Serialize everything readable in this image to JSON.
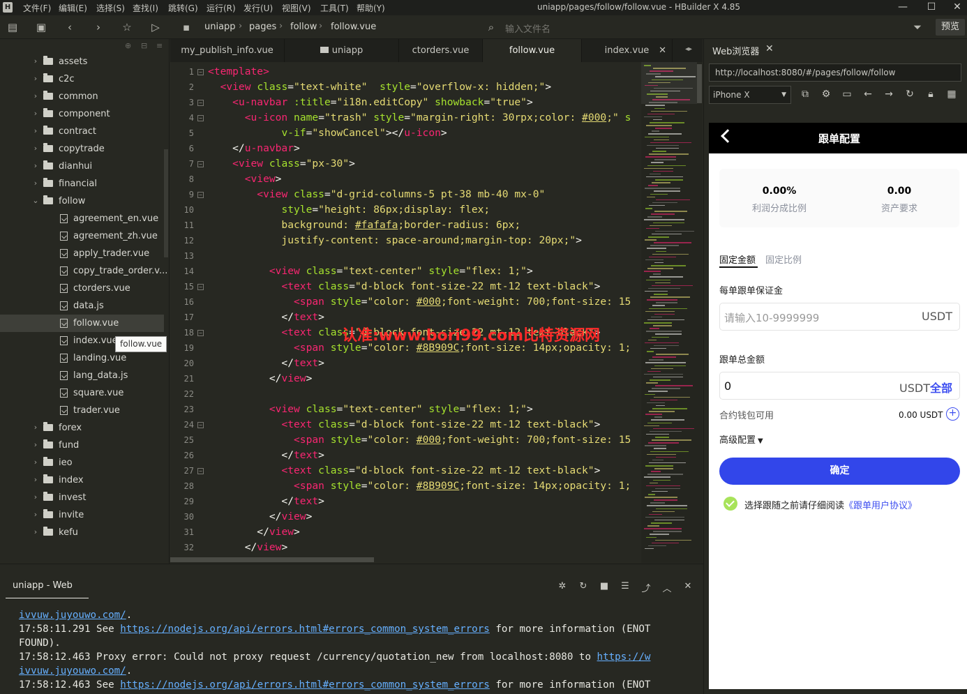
{
  "menubar": {
    "logo": "H",
    "items": [
      "文件(F)",
      "编辑(E)",
      "选择(S)",
      "查找(I)",
      "跳转(G)",
      "运行(R)",
      "发行(U)",
      "视图(V)",
      "工具(T)",
      "帮助(Y)"
    ],
    "title": "uniapp/pages/follow/follow.vue - HBuilder X 4.85"
  },
  "toolbar": {
    "breadcrumb": [
      "uniapp",
      "pages",
      "follow",
      "follow.vue"
    ],
    "search_placeholder": "输入文件名",
    "preview_label": "预览"
  },
  "sidebar": {
    "items": [
      {
        "label": "assets",
        "type": "folder"
      },
      {
        "label": "c2c",
        "type": "folder"
      },
      {
        "label": "common",
        "type": "folder"
      },
      {
        "label": "component",
        "type": "folder"
      },
      {
        "label": "contract",
        "type": "folder"
      },
      {
        "label": "copytrade",
        "type": "folder"
      },
      {
        "label": "dianhui",
        "type": "folder"
      },
      {
        "label": "financial",
        "type": "folder"
      },
      {
        "label": "follow",
        "type": "folder-open"
      },
      {
        "label": "agreement_en.vue",
        "type": "file"
      },
      {
        "label": "agreement_zh.vue",
        "type": "file"
      },
      {
        "label": "apply_trader.vue",
        "type": "file"
      },
      {
        "label": "copy_trade_order.v...",
        "type": "file"
      },
      {
        "label": "ctorders.vue",
        "type": "file"
      },
      {
        "label": "data.js",
        "type": "file"
      },
      {
        "label": "follow.vue",
        "type": "file",
        "active": true
      },
      {
        "label": "index.vue",
        "type": "file"
      },
      {
        "label": "landing.vue",
        "type": "file"
      },
      {
        "label": "lang_data.js",
        "type": "file"
      },
      {
        "label": "square.vue",
        "type": "file"
      },
      {
        "label": "trader.vue",
        "type": "file"
      },
      {
        "label": "forex",
        "type": "folder"
      },
      {
        "label": "fund",
        "type": "folder"
      },
      {
        "label": "ieo",
        "type": "folder"
      },
      {
        "label": "index",
        "type": "folder"
      },
      {
        "label": "invest",
        "type": "folder"
      },
      {
        "label": "invite",
        "type": "folder"
      },
      {
        "label": "kefu",
        "type": "folder"
      }
    ],
    "tooltip": "follow.vue"
  },
  "tabs": [
    {
      "label": "my_publish_info.vue"
    },
    {
      "label": "uniapp"
    },
    {
      "label": "ctorders.vue"
    },
    {
      "label": "follow.vue",
      "active": true
    },
    {
      "label": "index.vue"
    }
  ],
  "editor": {
    "lines": [
      {
        "n": "1",
        "fold": "-"
      },
      {
        "n": "2",
        "fold": ""
      },
      {
        "n": "3",
        "fold": "-"
      },
      {
        "n": "4",
        "fold": "-"
      },
      {
        "n": "5",
        "fold": ""
      },
      {
        "n": "6",
        "fold": ""
      },
      {
        "n": "7",
        "fold": "-"
      },
      {
        "n": "8",
        "fold": ""
      },
      {
        "n": "9",
        "fold": "-"
      },
      {
        "n": "10",
        "fold": ""
      },
      {
        "n": "11",
        "fold": ""
      },
      {
        "n": "12",
        "fold": ""
      },
      {
        "n": "13",
        "fold": ""
      },
      {
        "n": "14",
        "fold": ""
      },
      {
        "n": "15",
        "fold": "-"
      },
      {
        "n": "16",
        "fold": ""
      },
      {
        "n": "17",
        "fold": ""
      },
      {
        "n": "18",
        "fold": "-"
      },
      {
        "n": "19",
        "fold": ""
      },
      {
        "n": "20",
        "fold": ""
      },
      {
        "n": "21",
        "fold": ""
      },
      {
        "n": "22",
        "fold": ""
      },
      {
        "n": "23",
        "fold": ""
      },
      {
        "n": "24",
        "fold": "-"
      },
      {
        "n": "25",
        "fold": ""
      },
      {
        "n": "26",
        "fold": ""
      },
      {
        "n": "27",
        "fold": "-"
      },
      {
        "n": "28",
        "fold": ""
      },
      {
        "n": "29",
        "fold": ""
      },
      {
        "n": "30",
        "fold": ""
      },
      {
        "n": "31",
        "fold": ""
      },
      {
        "n": "32",
        "fold": ""
      }
    ],
    "watermark": "认准:www.bori99.com比特资源网"
  },
  "browser": {
    "title": "Web浏览器",
    "url": "http://localhost:8080/#/pages/follow/follow",
    "device": "iPhone X"
  },
  "phone": {
    "nav_title": "跟单配置",
    "stats": [
      {
        "value": "0.00%",
        "label": "利润分成比例"
      },
      {
        "value": "0.00",
        "label": "资产要求"
      }
    ],
    "tabs": [
      "固定金额",
      "固定比例"
    ],
    "margin_label": "每单跟单保证金",
    "margin_placeholder": "请输入10-9999999",
    "margin_unit": "USDT",
    "total_label": "跟单总金额",
    "total_value": "0",
    "total_unit": "USDT",
    "total_all": "全部",
    "avail_label": "合约钱包可用",
    "avail_value": "0.00 USDT",
    "adv_label": "高级配置",
    "confirm_label": "确定",
    "agree_text": "选择跟随之前请仔细阅读",
    "agree_link": "《跟单用户协议》"
  },
  "console": {
    "tab": "uniapp - Web",
    "lines": [
      [
        {
          "t": "ivvuw.juyouwo.com/",
          "link": true
        },
        {
          "t": "."
        }
      ],
      [
        {
          "t": "17:58:11.291 See "
        },
        {
          "t": "https://nodejs.org/api/errors.html#errors_common_system_errors",
          "link": true
        },
        {
          "t": " for more information (ENOT"
        }
      ],
      [
        {
          "t": "FOUND)."
        }
      ],
      [
        {
          "t": "17:58:12.463 Proxy error: Could not proxy request /currency/quotation_new from localhost:8080 to "
        },
        {
          "t": "https://w",
          "link": true
        }
      ],
      [
        {
          "t": "ivvuw.juyouwo.com/",
          "link": true
        },
        {
          "t": "."
        }
      ],
      [
        {
          "t": "17:58:12.463 See "
        },
        {
          "t": "https://nodejs.org/api/errors.html#errors_common_system_errors",
          "link": true
        },
        {
          "t": " for more information (ENOT"
        }
      ]
    ]
  }
}
